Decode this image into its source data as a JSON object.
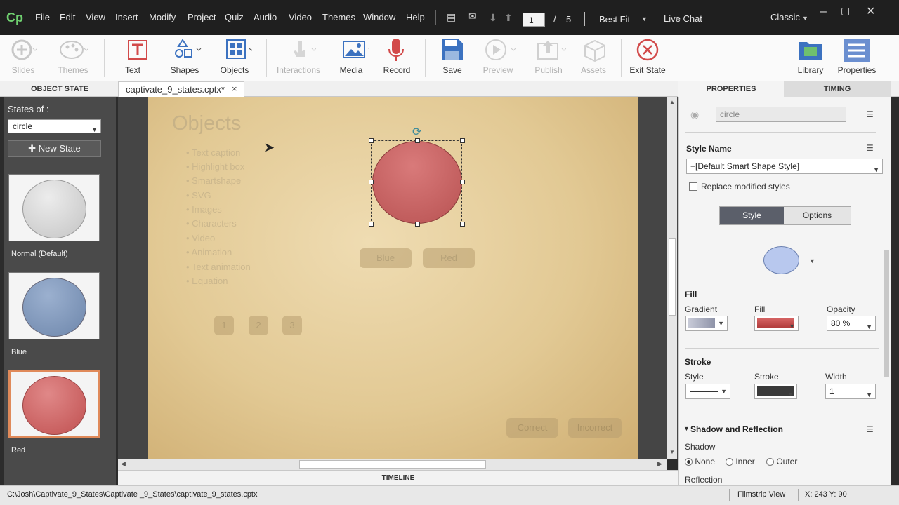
{
  "app": {
    "logo": "Cp",
    "menu": [
      "File",
      "Edit",
      "View",
      "Insert",
      "Modify",
      "Project",
      "Quiz",
      "Audio",
      "Video",
      "Themes",
      "Window",
      "Help"
    ],
    "page_current": "1",
    "page_separator": "/",
    "page_total": "5",
    "zoom": "Best Fit",
    "live_chat": "Live Chat",
    "workspace": "Classic"
  },
  "toolbar": {
    "slides": "Slides",
    "themes": "Themes",
    "text": "Text",
    "shapes": "Shapes",
    "objects": "Objects",
    "interactions": "Interactions",
    "media": "Media",
    "record": "Record",
    "save": "Save",
    "preview": "Preview",
    "publish": "Publish",
    "assets": "Assets",
    "exit_state": "Exit State",
    "library": "Library",
    "properties": "Properties"
  },
  "tabs": {
    "object_state": "OBJECT STATE",
    "document": "captivate_9_states.cptx*",
    "close": "×",
    "properties": "PROPERTIES",
    "timing": "TIMING"
  },
  "states": {
    "label": "States of :",
    "selected": "circle",
    "new_state": "New State",
    "items": [
      {
        "label": "Normal (Default)",
        "color": "#d0d0d0"
      },
      {
        "label": "Blue",
        "color": "#7a93b8"
      },
      {
        "label": "Red",
        "color": "#c85a5a"
      }
    ]
  },
  "slide": {
    "title": "Objects",
    "list": [
      "Text caption",
      "Highlight box",
      "Smartshape",
      "SVG",
      "Images",
      "Characters",
      "Video",
      "Animation",
      "Text animation",
      "Equation"
    ],
    "buttons": {
      "blue": "Blue",
      "red": "Red",
      "n1": "1",
      "n2": "2",
      "n3": "3",
      "correct": "Correct",
      "incorrect": "Incorrect"
    },
    "circle_color": "#c85a5a"
  },
  "timeline": "TIMELINE",
  "properties": {
    "object_name": "circle",
    "style_name_label": "Style Name",
    "style_name": "+[Default Smart Shape Style]",
    "replace_label": "Replace modified styles",
    "subtab_style": "Style",
    "subtab_options": "Options",
    "fill_section": "Fill",
    "gradient_label": "Gradient",
    "fill_label": "Fill",
    "opacity_label": "Opacity",
    "opacity": "80 %",
    "stroke_section": "Stroke",
    "stroke_style_label": "Style",
    "stroke_label": "Stroke",
    "width_label": "Width",
    "width": "1",
    "shadow_section": "Shadow and Reflection",
    "shadow_label": "Shadow",
    "shadow_none": "None",
    "shadow_inner": "Inner",
    "shadow_outer": "Outer",
    "reflection_label": "Reflection"
  },
  "status": {
    "path": "C:\\Josh\\Captivate_9_States\\Captivate _9_States\\captivate_9_states.cptx",
    "view": "Filmstrip View",
    "coords": "X: 243 Y: 90"
  }
}
